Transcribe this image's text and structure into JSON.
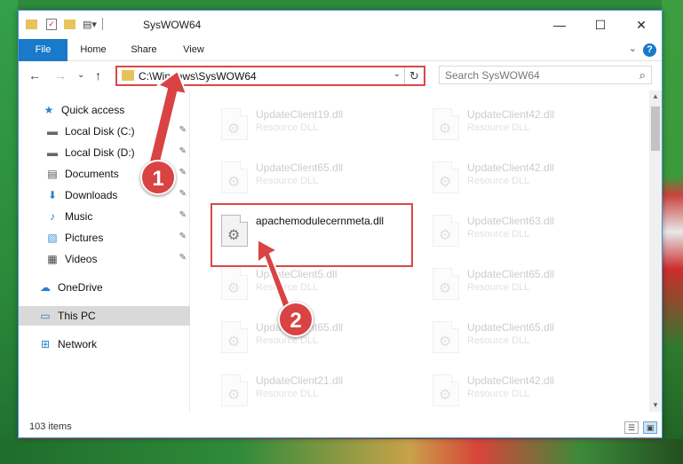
{
  "window": {
    "title": "SysWOW64",
    "minimize_glyph": "—",
    "maximize_glyph": "☐",
    "close_glyph": "✕"
  },
  "ribbon": {
    "tabs": [
      {
        "label": "File"
      },
      {
        "label": "Home"
      },
      {
        "label": "Share"
      },
      {
        "label": "View"
      }
    ],
    "help_glyph": "?",
    "collapse_glyph": "⌄"
  },
  "nav": {
    "back_glyph": "←",
    "forward_glyph": "→",
    "recent_glyph": "⌄",
    "up_glyph": "↑",
    "address": "C:\\Windows\\SysWOW64",
    "address_dropdown_glyph": "⌄",
    "refresh_glyph": "↻",
    "search_placeholder": "Search SysWOW64",
    "search_icon": "⌕"
  },
  "sidebar": {
    "items": [
      {
        "label": "Quick access",
        "icon": "star-icon",
        "glyph": "★",
        "pinned": false
      },
      {
        "label": "Local Disk (C:)",
        "icon": "drive-icon",
        "glyph": "▬",
        "pinned": true
      },
      {
        "label": "Local Disk (D:)",
        "icon": "drive-icon",
        "glyph": "▬",
        "pinned": true
      },
      {
        "label": "Documents",
        "icon": "documents-icon",
        "glyph": "▤",
        "pinned": true
      },
      {
        "label": "Downloads",
        "icon": "download-icon",
        "glyph": "⬇",
        "pinned": true
      },
      {
        "label": "Music",
        "icon": "music-icon",
        "glyph": "♪",
        "pinned": true
      },
      {
        "label": "Pictures",
        "icon": "pictures-icon",
        "glyph": "▧",
        "pinned": true
      },
      {
        "label": "Videos",
        "icon": "videos-icon",
        "glyph": "▦",
        "pinned": true
      },
      {
        "label": "OneDrive",
        "icon": "cloud-icon",
        "glyph": "☁",
        "pinned": false
      },
      {
        "label": "This PC",
        "icon": "computer-icon",
        "glyph": "▭",
        "pinned": false
      },
      {
        "label": "Network",
        "icon": "network-icon",
        "glyph": "⊞",
        "pinned": false
      }
    ],
    "pin_glyph": "📌"
  },
  "files": [
    {
      "name": "UpdateClient19.dll",
      "type": "Resource DLL",
      "faded": true
    },
    {
      "name": "UpdateClient42.dll",
      "type": "Resource DLL",
      "faded": true
    },
    {
      "name": "UpdateClient65.dll",
      "type": "Resource DLL",
      "faded": true
    },
    {
      "name": "UpdateClient42.dll",
      "type": "Resource DLL",
      "faded": true
    },
    {
      "name": "apachemodulecernmeta.dll",
      "type": "",
      "faded": false
    },
    {
      "name": "UpdateClient63.dll",
      "type": "Resource DLL",
      "faded": true
    },
    {
      "name": "UpdateClient5.dll",
      "type": "Resource DLL",
      "faded": true
    },
    {
      "name": "UpdateClient65.dll",
      "type": "Resource DLL",
      "faded": true
    },
    {
      "name": "UpdateClient65.dll",
      "type": "Resource DLL",
      "faded": true
    },
    {
      "name": "UpdateClient65.dll",
      "type": "Resource DLL",
      "faded": true
    },
    {
      "name": "UpdateClient21.dll",
      "type": "Resource DLL",
      "faded": true
    },
    {
      "name": "UpdateClient42.dll",
      "type": "Resource DLL",
      "faded": true
    }
  ],
  "status": {
    "count": "103 items"
  },
  "annotations": {
    "step1": "1",
    "step2": "2"
  },
  "colors": {
    "accent": "#1979ca",
    "highlight": "#d84848",
    "badge": "#d94343"
  }
}
